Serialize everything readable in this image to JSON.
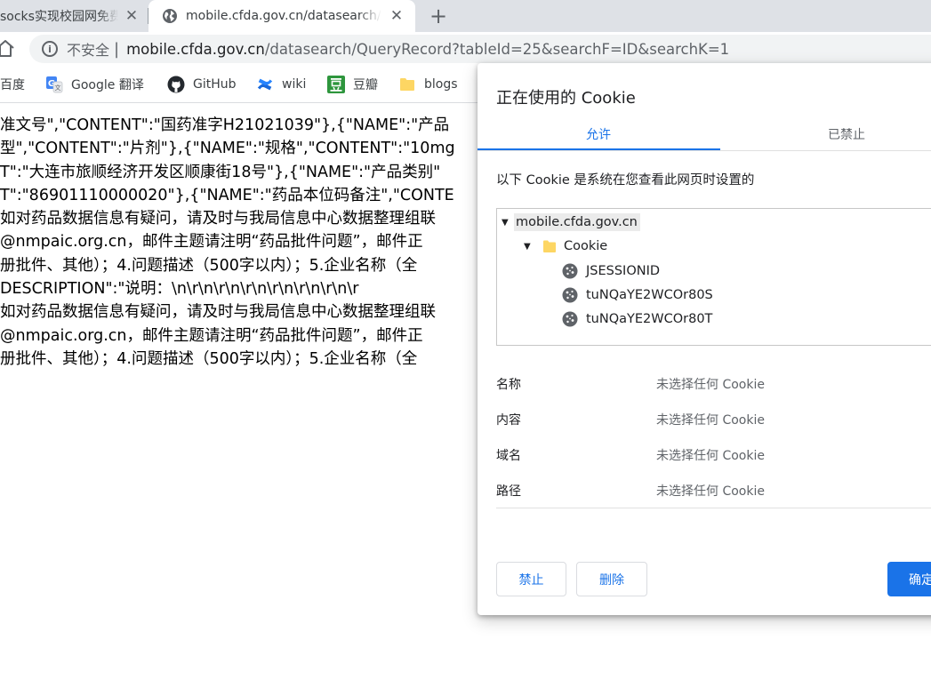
{
  "tabs": [
    {
      "title": "socks实现校园网免费上网",
      "active": false
    },
    {
      "title": "mobile.cfda.gov.cn/datasearch/QueryRecord",
      "active": true
    }
  ],
  "new_tab_symbol": "+",
  "toolbar": {
    "security_label": "不安全",
    "separator": "|",
    "url_host": "mobile.cfda.gov.cn",
    "url_path": "/datasearch/QueryRecord?tableId=25&searchF=ID&searchK=1"
  },
  "bookmarks": [
    {
      "label": "百度",
      "icon": "baidu-icon"
    },
    {
      "label": "Google 翻译",
      "icon": "google-translate-icon"
    },
    {
      "label": "GitHub",
      "icon": "github-icon"
    },
    {
      "label": "wiki",
      "icon": "confluence-icon"
    },
    {
      "label": "豆瓣",
      "icon": "douban-icon"
    },
    {
      "label": "blogs",
      "icon": "folder-icon"
    }
  ],
  "page_lines": [
    "准文号\",\"CONTENT\":\"国药准字H21021039\"},{\"NAME\":\"产品",
    "型\",\"CONTENT\":\"片剂\"},{\"NAME\":\"规格\",\"CONTENT\":\"10mg",
    "T\":\"大连市旅顺经济开发区顺康街18号\"},{\"NAME\":\"产品类别\"",
    "T\":\"86901110000020\"},{\"NAME\":\"药品本位码备注\",\"CONTE",
    "如对药品数据信息有疑问，请及时与我局信息中心数据整理组联",
    "@nmpaic.org.cn，邮件主题请注明“药品批件问题”，邮件正",
    "册批件、其他）；4.问题描述（500字以内）；5.企业名称（全",
    "DESCRIPTION\":\"说明：\\n\\r\\n\\r\\n\\r\\n\\r\\n\\r\\n\\r\\n\\r",
    "如对药品数据信息有疑问，请及时与我局信息中心数据整理组联",
    "@nmpaic.org.cn，邮件主题请注明“药品批件问题”，邮件正",
    "册批件、其他）；4.问题描述（500字以内）；5.企业名称（全"
  ],
  "dialog": {
    "title": "正在使用的 Cookie",
    "tab_allowed": "允许",
    "tab_blocked": "已禁止",
    "description": "以下 Cookie 是系统在您查看此网页时设置的",
    "tree": {
      "domain": "mobile.cfda.gov.cn",
      "folder": "Cookie",
      "cookies": [
        "JSESSIONID",
        "tuNQaYE2WCOr80S",
        "tuNQaYE2WCOr80T"
      ]
    },
    "details": [
      {
        "key": "名称",
        "value": "未选择任何 Cookie"
      },
      {
        "key": "内容",
        "value": "未选择任何 Cookie"
      },
      {
        "key": "域名",
        "value": "未选择任何 Cookie"
      },
      {
        "key": "路径",
        "value": "未选择任何 Cookie"
      }
    ],
    "buttons": {
      "block": "禁止",
      "remove": "删除",
      "done": "确定"
    }
  },
  "colors": {
    "accent": "#1a73e8",
    "tab_strip": "#dee1e6",
    "omnibox": "#f1f3f4"
  }
}
